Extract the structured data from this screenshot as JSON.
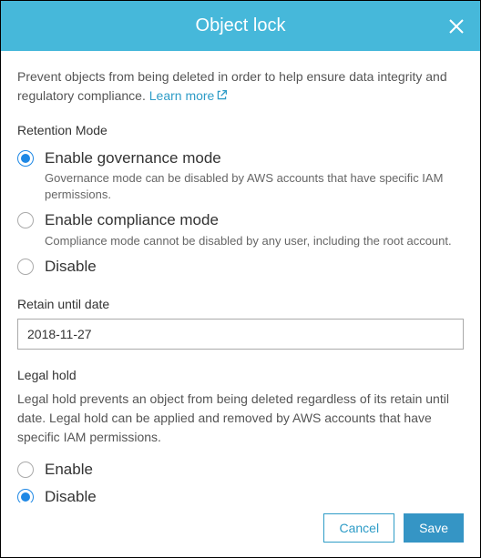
{
  "header": {
    "title": "Object lock"
  },
  "intro": {
    "text": "Prevent objects from being deleted in order to help ensure data integrity and regulatory compliance. ",
    "link_text": "Learn more"
  },
  "retention": {
    "label": "Retention Mode",
    "options": {
      "governance": {
        "label": "Enable governance mode",
        "desc": "Governance mode can be disabled by AWS accounts that have specific IAM permissions.",
        "selected": true
      },
      "compliance": {
        "label": "Enable compliance mode",
        "desc": "Compliance mode cannot be disabled by any user, including the root account.",
        "selected": false
      },
      "disable": {
        "label": "Disable",
        "selected": false
      }
    }
  },
  "retain_until": {
    "label": "Retain until date",
    "value": "2018-11-27"
  },
  "legal_hold": {
    "label": "Legal hold",
    "desc": "Legal hold prevents an object from being deleted regardless of its retain until date. Legal hold can be applied and removed by AWS accounts that have specific IAM permissions.",
    "options": {
      "enable": {
        "label": "Enable",
        "selected": false
      },
      "disable": {
        "label": "Disable",
        "selected": true
      }
    }
  },
  "footer": {
    "cancel": "Cancel",
    "save": "Save"
  }
}
